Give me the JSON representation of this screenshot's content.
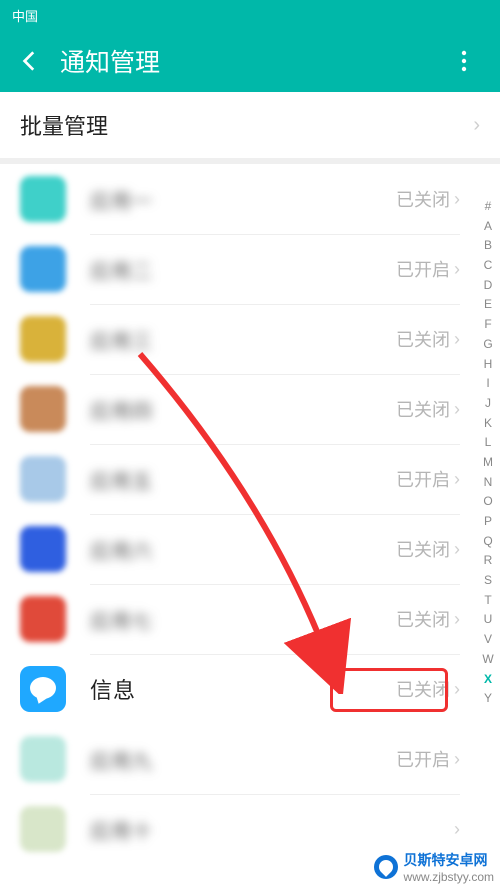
{
  "statusbar": {
    "carrier": "中国"
  },
  "header": {
    "title": "通知管理"
  },
  "batch": {
    "label": "批量管理"
  },
  "status_labels": {
    "off": "已关闭",
    "on": "已开启"
  },
  "apps": [
    {
      "name": "应用一",
      "status": "off",
      "icon_color": "#3fd0c9",
      "blurred": true
    },
    {
      "name": "应用二",
      "status": "on",
      "icon_color": "#3da2e6",
      "blurred": true
    },
    {
      "name": "应用三",
      "status": "off",
      "icon_color": "#d9b23a",
      "blurred": true
    },
    {
      "name": "应用四",
      "status": "off",
      "icon_color": "#c98a5a",
      "blurred": true
    },
    {
      "name": "应用五",
      "status": "on",
      "icon_color": "#a8c9e8",
      "blurred": true
    },
    {
      "name": "应用六",
      "status": "off",
      "icon_color": "#2f5fe0",
      "blurred": true
    },
    {
      "name": "应用七",
      "status": "off",
      "icon_color": "#e04a3a",
      "blurred": true
    },
    {
      "name": "信息",
      "status": "off",
      "icon_color": "#1fa8ff",
      "blurred": false,
      "highlighted": true
    },
    {
      "name": "应用九",
      "status": "on",
      "icon_color": "#b9e8df",
      "blurred": true
    },
    {
      "name": "应用十",
      "status": "",
      "icon_color": "#d8e6c9",
      "blurred": true
    }
  ],
  "index_letters": [
    "#",
    "A",
    "B",
    "C",
    "D",
    "E",
    "F",
    "G",
    "H",
    "I",
    "J",
    "K",
    "L",
    "M",
    "N",
    "O",
    "P",
    "Q",
    "R",
    "S",
    "T",
    "U",
    "V",
    "W",
    "X",
    "Y"
  ],
  "index_accent": "X",
  "watermark": {
    "title": "贝斯特安卓网",
    "url": "www.zjbstyy.com"
  },
  "colors": {
    "accent": "#00b8a9",
    "highlight": "#f03030",
    "link": "#0e72d6"
  }
}
